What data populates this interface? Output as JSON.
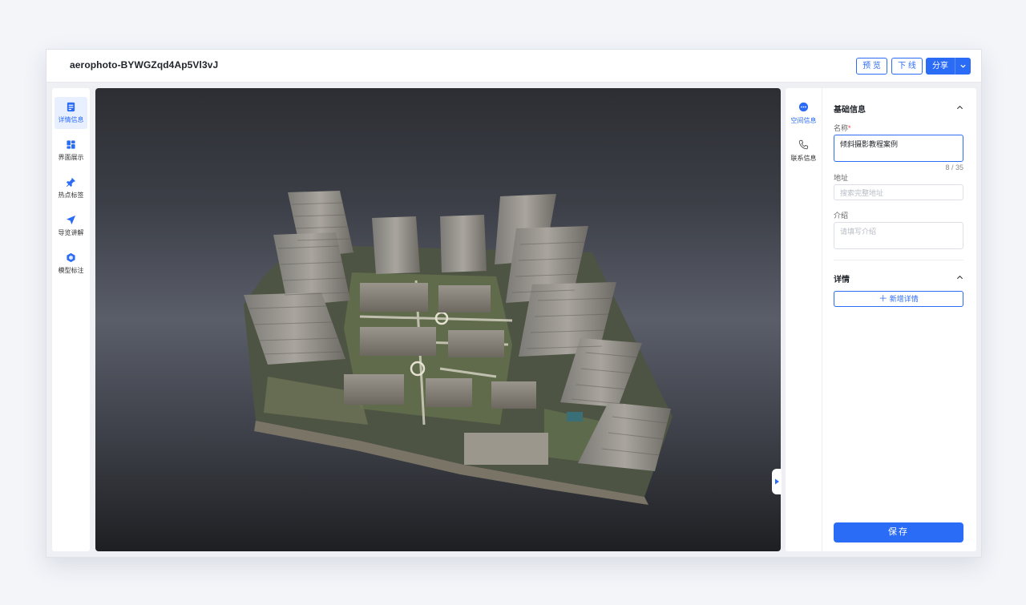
{
  "header": {
    "title": "aerophoto-BYWGZqd4Ap5Vl3vJ",
    "preview_label": "预 览",
    "offline_label": "下 线",
    "share_label": "分享"
  },
  "sidebar": {
    "items": [
      {
        "label": "详情信息",
        "icon": "detail-icon",
        "active": true
      },
      {
        "label": "界面展示",
        "icon": "layout-icon",
        "active": false
      },
      {
        "label": "热点标签",
        "icon": "pin-icon",
        "active": false
      },
      {
        "label": "导览讲解",
        "icon": "navigation-icon",
        "active": false
      },
      {
        "label": "模型标注",
        "icon": "model-icon",
        "active": false
      }
    ]
  },
  "panel": {
    "tabs": [
      {
        "label": "空间信息",
        "icon": "chat-icon",
        "active": true
      },
      {
        "label": "联系信息",
        "icon": "phone-icon",
        "active": false
      }
    ],
    "basic": {
      "title": "基础信息",
      "name_label": "名称",
      "name_required": "*",
      "name_value": "倾斜摄影教程案例",
      "name_counter": "8 / 35",
      "address_label": "地址",
      "address_placeholder": "搜索完整地址",
      "intro_label": "介绍",
      "intro_placeholder": "请填写介绍"
    },
    "details": {
      "title": "详情",
      "add_label": "新增详情"
    },
    "save_label": "保存"
  },
  "colors": {
    "accent": "#2b6cf6",
    "required": "#f5423b"
  }
}
